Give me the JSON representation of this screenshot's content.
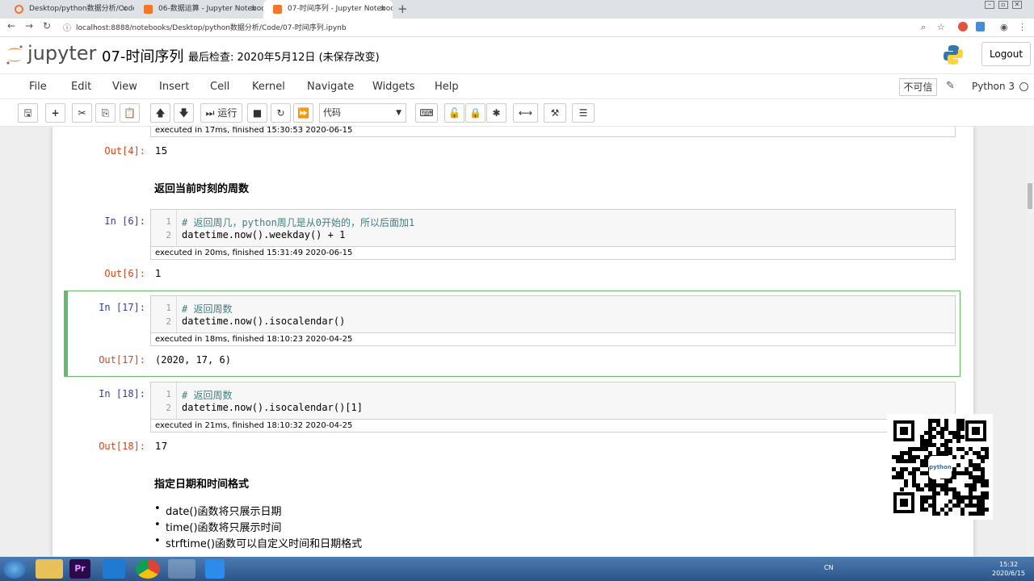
{
  "browser": {
    "tabs": [
      {
        "title": "Desktop/python数据分析/Code/",
        "icon_color": "#f37726",
        "active": false
      },
      {
        "title": "06-数据运算 - Jupyter Notebook",
        "icon_color": "#f37726",
        "active": false
      },
      {
        "title": "07-时间序列 - Jupyter Notebook",
        "icon_color": "#f37726",
        "active": true
      }
    ],
    "new_tab": "+",
    "url": "localhost:8888/notebooks/Desktop/python数据分析/Code/07-时间序列.ipynb"
  },
  "header": {
    "logo_text": "jupyter",
    "notebook_name": "07-时间序列",
    "checkpoint": "最后检查: 2020年5月12日",
    "autosave": "(未保存改变)",
    "logout": "Logout"
  },
  "menubar": {
    "items": [
      "File",
      "Edit",
      "View",
      "Insert",
      "Cell",
      "Kernel",
      "Navigate",
      "Widgets",
      "Help"
    ],
    "trust": "不可信",
    "kernel": "Python 3"
  },
  "toolbar": {
    "run_label": "运行",
    "cell_type": "代码"
  },
  "notebook": {
    "top_exec": "executed in 17ms, finished 15:30:53 2020-06-15",
    "out4_prompt": "Out[4]:",
    "out4_value": "15",
    "heading1": "返回当前时刻的周数",
    "cell6": {
      "in_prompt": "In  [6]:",
      "lines": [
        "# 返回周几，python周几是从0开始的，所以后面加1",
        "datetime.now().weekday() + 1"
      ],
      "exec": "executed in 20ms, finished 15:31:49 2020-06-15",
      "out_prompt": "Out[6]:",
      "out_value": "1"
    },
    "cell17": {
      "in_prompt": "In  [17]:",
      "lines": [
        "# 返回周数",
        "datetime.now().isocalendar()"
      ],
      "exec": "executed in 18ms, finished 18:10:23 2020-04-25",
      "out_prompt": "Out[17]:",
      "out_value": "(2020,  17,  6)"
    },
    "cell18": {
      "in_prompt": "In  [18]:",
      "lines": [
        "# 返回周数",
        "datetime.now().isocalendar()[1]"
      ],
      "exec": "executed in 21ms, finished 18:10:32 2020-04-25",
      "out_prompt": "Out[18]:",
      "out_value": "17"
    },
    "heading2": "指定日期和时间格式",
    "bullets": [
      "date()函数将只展示日期",
      "time()函数将只展示时间",
      "strftime()函数可以自定义时间和日期格式"
    ]
  },
  "qr_badge": "python",
  "taskbar": {
    "lang": "CN",
    "time": "15:32",
    "date": "2020/6/15"
  }
}
